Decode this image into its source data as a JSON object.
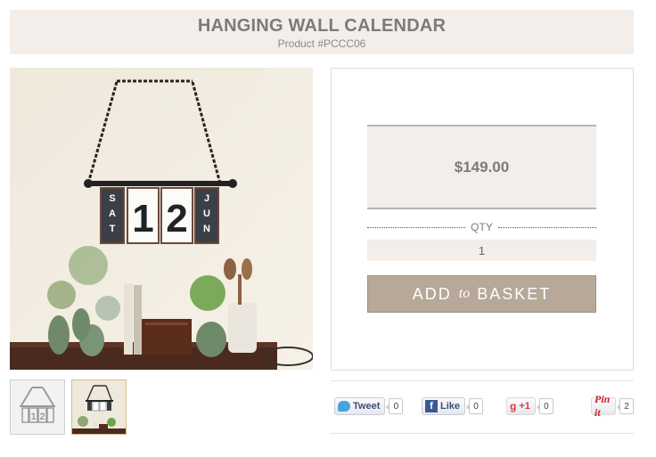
{
  "product": {
    "title": "HANGING WALL CALENDAR",
    "product_number": "Product #PCCC06",
    "calendar_cards": [
      "SAT",
      "1",
      "2",
      "JUN"
    ]
  },
  "purchase": {
    "price": "$149.00",
    "qty_label": "QTY",
    "qty_value": "1",
    "add_label_prefix": "ADD",
    "add_label_mid": "to",
    "add_label_suffix": "BASKET"
  },
  "social": {
    "tweet": {
      "label": "Tweet",
      "count": "0"
    },
    "like": {
      "label": "Like",
      "count": "0"
    },
    "gplus": {
      "label": "+1",
      "count": "0"
    },
    "pinit": {
      "label": "Pin it",
      "count": "2"
    }
  },
  "thumbnails": [
    "line-drawing",
    "photo"
  ],
  "colors": {
    "header_bg": "#f3eee9",
    "button_bg": "#b8a89a",
    "text": "#7b7b7b"
  },
  "icons": [
    "twitter-icon",
    "facebook-icon",
    "google-plus-icon",
    "pinterest-icon"
  ]
}
